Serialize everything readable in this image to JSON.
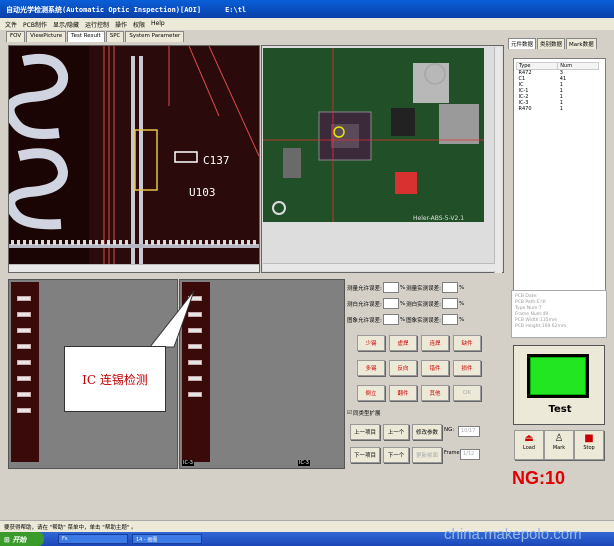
{
  "window": {
    "title": "自动光学检测系统(Automatic Optic Inspection)[AOI]",
    "path": "E:\\tl"
  },
  "menu": [
    "文件",
    "PCB制作",
    "显示/隐藏",
    "运行控制",
    "操作",
    "权限",
    "Help"
  ],
  "tabs": [
    "FOV",
    "ViewPicture",
    "Test Result",
    "SPC",
    "System Parameter"
  ],
  "active_tab": "Test Result",
  "image": {
    "left_labels": {
      "ref": "C137",
      "ic": "U103"
    },
    "right_board_text": "Heler-ABS-5-V2.1"
  },
  "thumbnails": [
    {
      "label": "IC-3"
    },
    {
      "label": "IC-3"
    }
  ],
  "callout_text": "IC 连锡检测",
  "controls": {
    "rows": [
      {
        "left_label": "测量允许误差:",
        "right_label": "测量实测误差:"
      },
      {
        "left_label": "测白允许误差:",
        "right_label": "测白实测误差:"
      },
      {
        "left_label": "图象允许误差:",
        "right_label": "图象实测误差:"
      }
    ],
    "unit": "%",
    "defects": [
      "少锡",
      "虚焊",
      "连焊",
      "缺件",
      "多锡",
      "反向",
      "错件",
      "损件",
      "倒立",
      "翻件",
      "其他",
      "OK"
    ],
    "same_type_label": "同类型扩展",
    "prev_item": "上一项目",
    "prev": "上一个",
    "modify": "修改参数",
    "ng_label": "NG:",
    "ng_count": "10/17",
    "next_item": "下一项目",
    "next": "下一个",
    "change_frame": "更新帧面",
    "frame_label": "Frame:",
    "frame_value": "1/12"
  },
  "right_tabs": [
    "元件数据",
    "类别数据",
    "Mark数据"
  ],
  "part_list": {
    "headers": [
      "Type",
      "Num"
    ],
    "rows": [
      [
        "R472",
        "3"
      ],
      [
        "C1",
        "41"
      ],
      [
        "IC",
        "1"
      ],
      [
        "IC-1",
        "1"
      ],
      [
        "IC-2",
        "1"
      ],
      [
        "IC-3",
        "1"
      ],
      [
        "R470",
        "1"
      ]
    ]
  },
  "pcb_info": [
    "PCB Date:",
    "PCB Path:E:\\tl",
    "Type Num:7",
    "Frame Num:49",
    "PCB Width:135mm",
    "PCB Height:109.62mm"
  ],
  "status": {
    "text": "Test",
    "led_color": "#22e622"
  },
  "actions": {
    "load": "Load",
    "mark": "Mark",
    "stop": "Stop"
  },
  "ng_display": "NG:10",
  "statusbar_text": "要获得帮助，请在 \"帮助\" 菜单中，单击 \"帮助主题\" 。",
  "taskbar": {
    "start": "开始",
    "tasks": [
      "Fs",
      "14 - 画图"
    ]
  },
  "watermark": "china.makepolo.com"
}
